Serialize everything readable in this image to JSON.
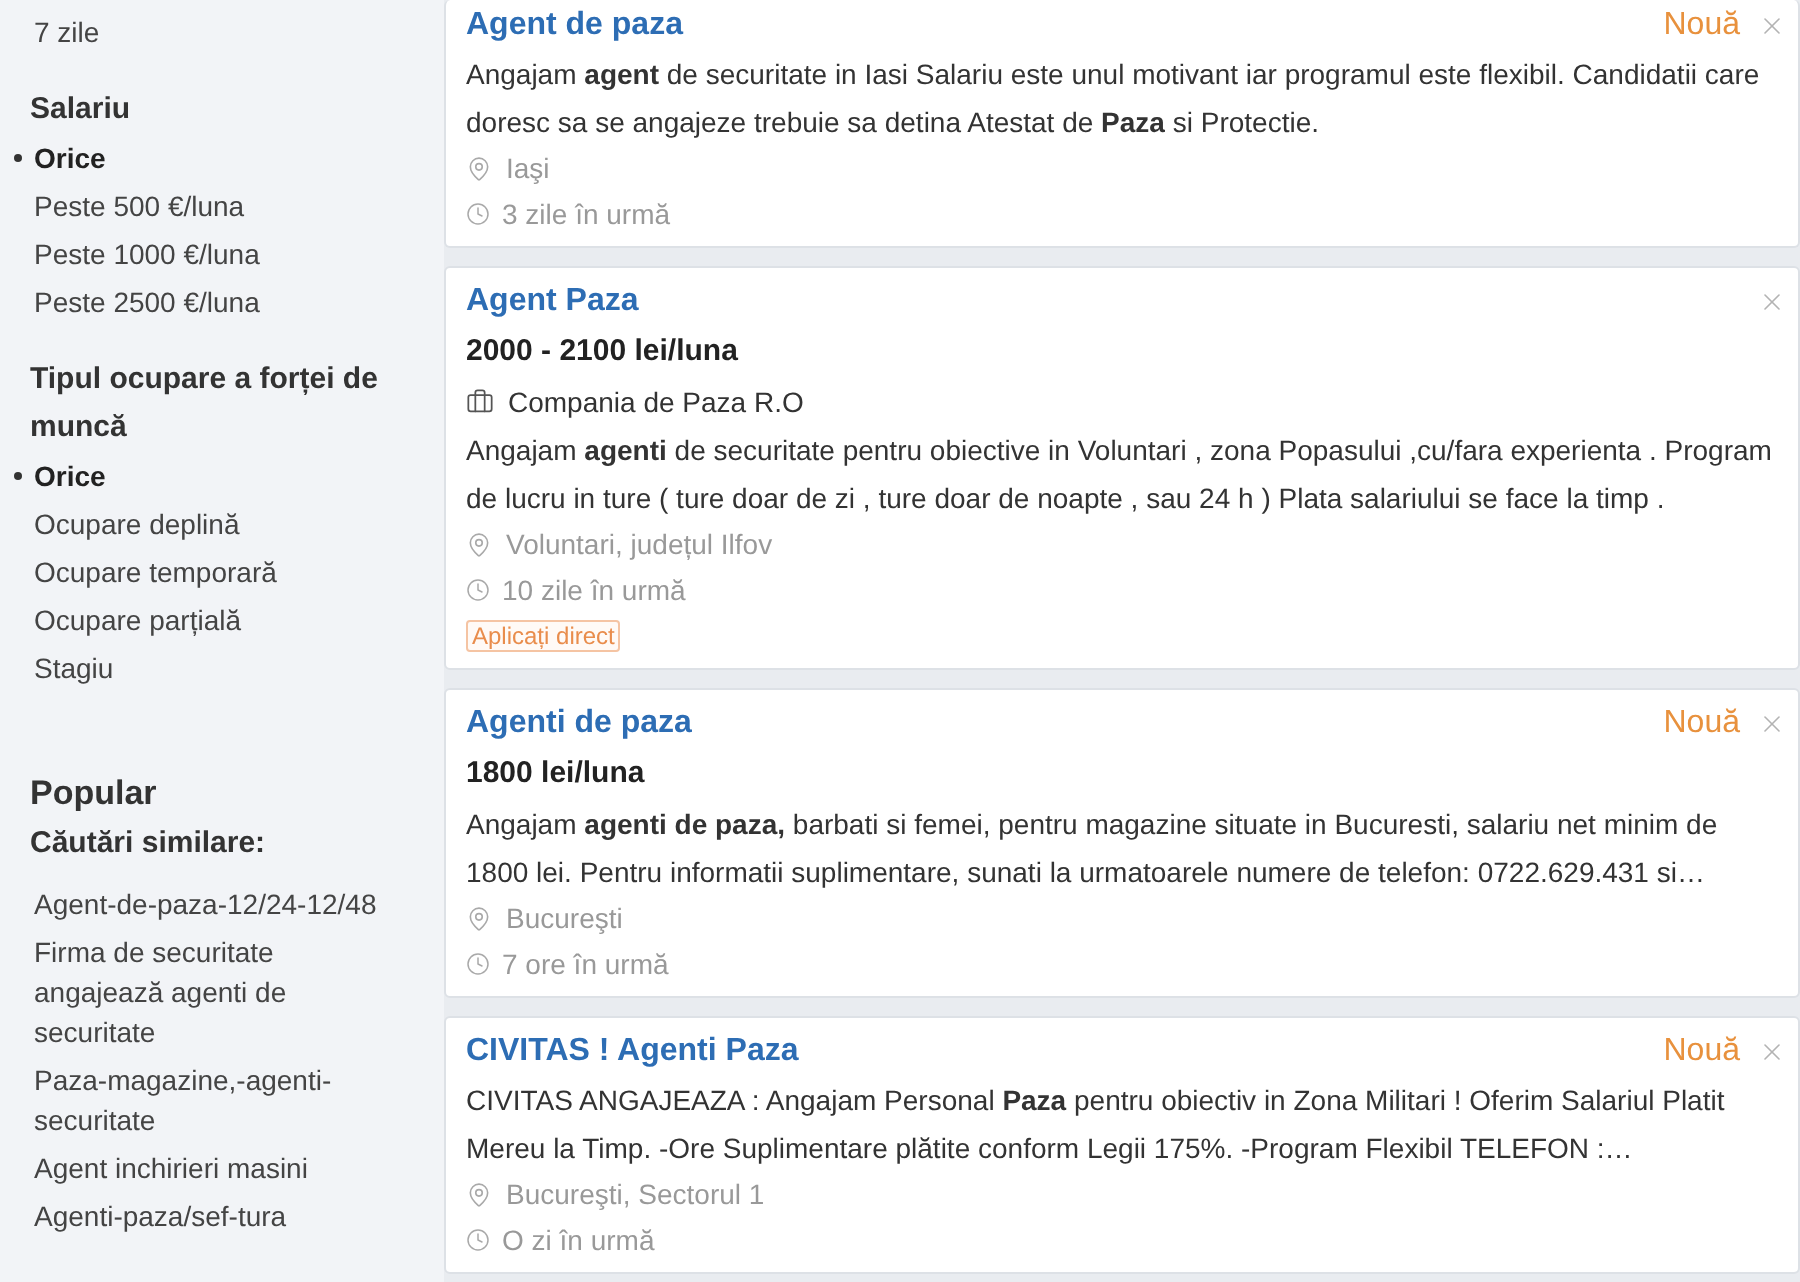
{
  "sidebar": {
    "filter_groups": [
      {
        "options": [
          {
            "label": "7 zile",
            "selected": false
          }
        ]
      },
      {
        "heading": "Salariu",
        "options": [
          {
            "label": "Orice",
            "selected": true
          },
          {
            "label": "Peste 500 €/luna",
            "selected": false
          },
          {
            "label": "Peste 1000 €/luna",
            "selected": false
          },
          {
            "label": "Peste 2500 €/luna",
            "selected": false
          }
        ]
      },
      {
        "heading": "Tipul ocupare a forței de muncă",
        "options": [
          {
            "label": "Orice",
            "selected": true
          },
          {
            "label": "Ocupare deplină",
            "selected": false
          },
          {
            "label": "Ocupare temporară",
            "selected": false
          },
          {
            "label": "Ocupare parțială",
            "selected": false
          },
          {
            "label": "Stagiu",
            "selected": false
          }
        ]
      }
    ],
    "popular": {
      "heading": "Popular",
      "subheading": "Căutări similare:",
      "links": [
        "Agent-de-paza-12/24-12/48",
        "Firma de securitate angajează agenti de securitate",
        "Paza-magazine,-agenti-securitate",
        "Agent inchirieri masini",
        "Agenti-paza/sef-tura"
      ]
    }
  },
  "jobs": [
    {
      "title": "Agent de paza",
      "badge": "Nouă",
      "description": "Angajam **agent** de securitate in Iasi Salariu este unul motivant iar programul este flexibil. Candidatii care doresc sa se angajeze trebuie sa detina Atestat de **Paza** si Protectie.",
      "location": "Iaşi",
      "posted": "3 zile în urmă"
    },
    {
      "title": "Agent Paza",
      "salary": "2000 - 2100 lei/luna",
      "company": "Compania de Paza R.O",
      "description": "Angajam **agenti** de securitate pentru obiective in Voluntari , zona Popasului ,cu/fara experienta . Program de lucru in ture ( ture doar de zi , ture doar de noapte , sau 24 h ) Plata salariului se face la timp .",
      "location": "Voluntari, județul Ilfov",
      "posted": "10 zile în urmă",
      "apply_label": "Aplicați direct"
    },
    {
      "title": "Agenti de paza",
      "badge": "Nouă",
      "salary": "1800 lei/luna",
      "description": "Angajam **agenti de paza,** barbati si femei, pentru magazine situate in Bucuresti, salariu net minim de 1800 lei. Pentru informatii suplimentare, sunati la urmatoarele numere de telefon: 0722.629.431 si…",
      "location": "Bucureşti",
      "posted": "7 ore în urmă"
    },
    {
      "title": "CIVITAS ! Agenti Paza",
      "badge": "Nouă",
      "description": "CIVITAS ANGAJEAZA : Angajam Personal **Paza** pentru obiectiv in Zona Militari ! Oferim Salariul Platit Mereu la Timp. -Ore Suplimentare plătite conform Legii 175%. -Program Flexibil TELEFON :…",
      "location": "Bucureşti, Sectorul 1",
      "posted": "O zi în urmă"
    }
  ]
}
